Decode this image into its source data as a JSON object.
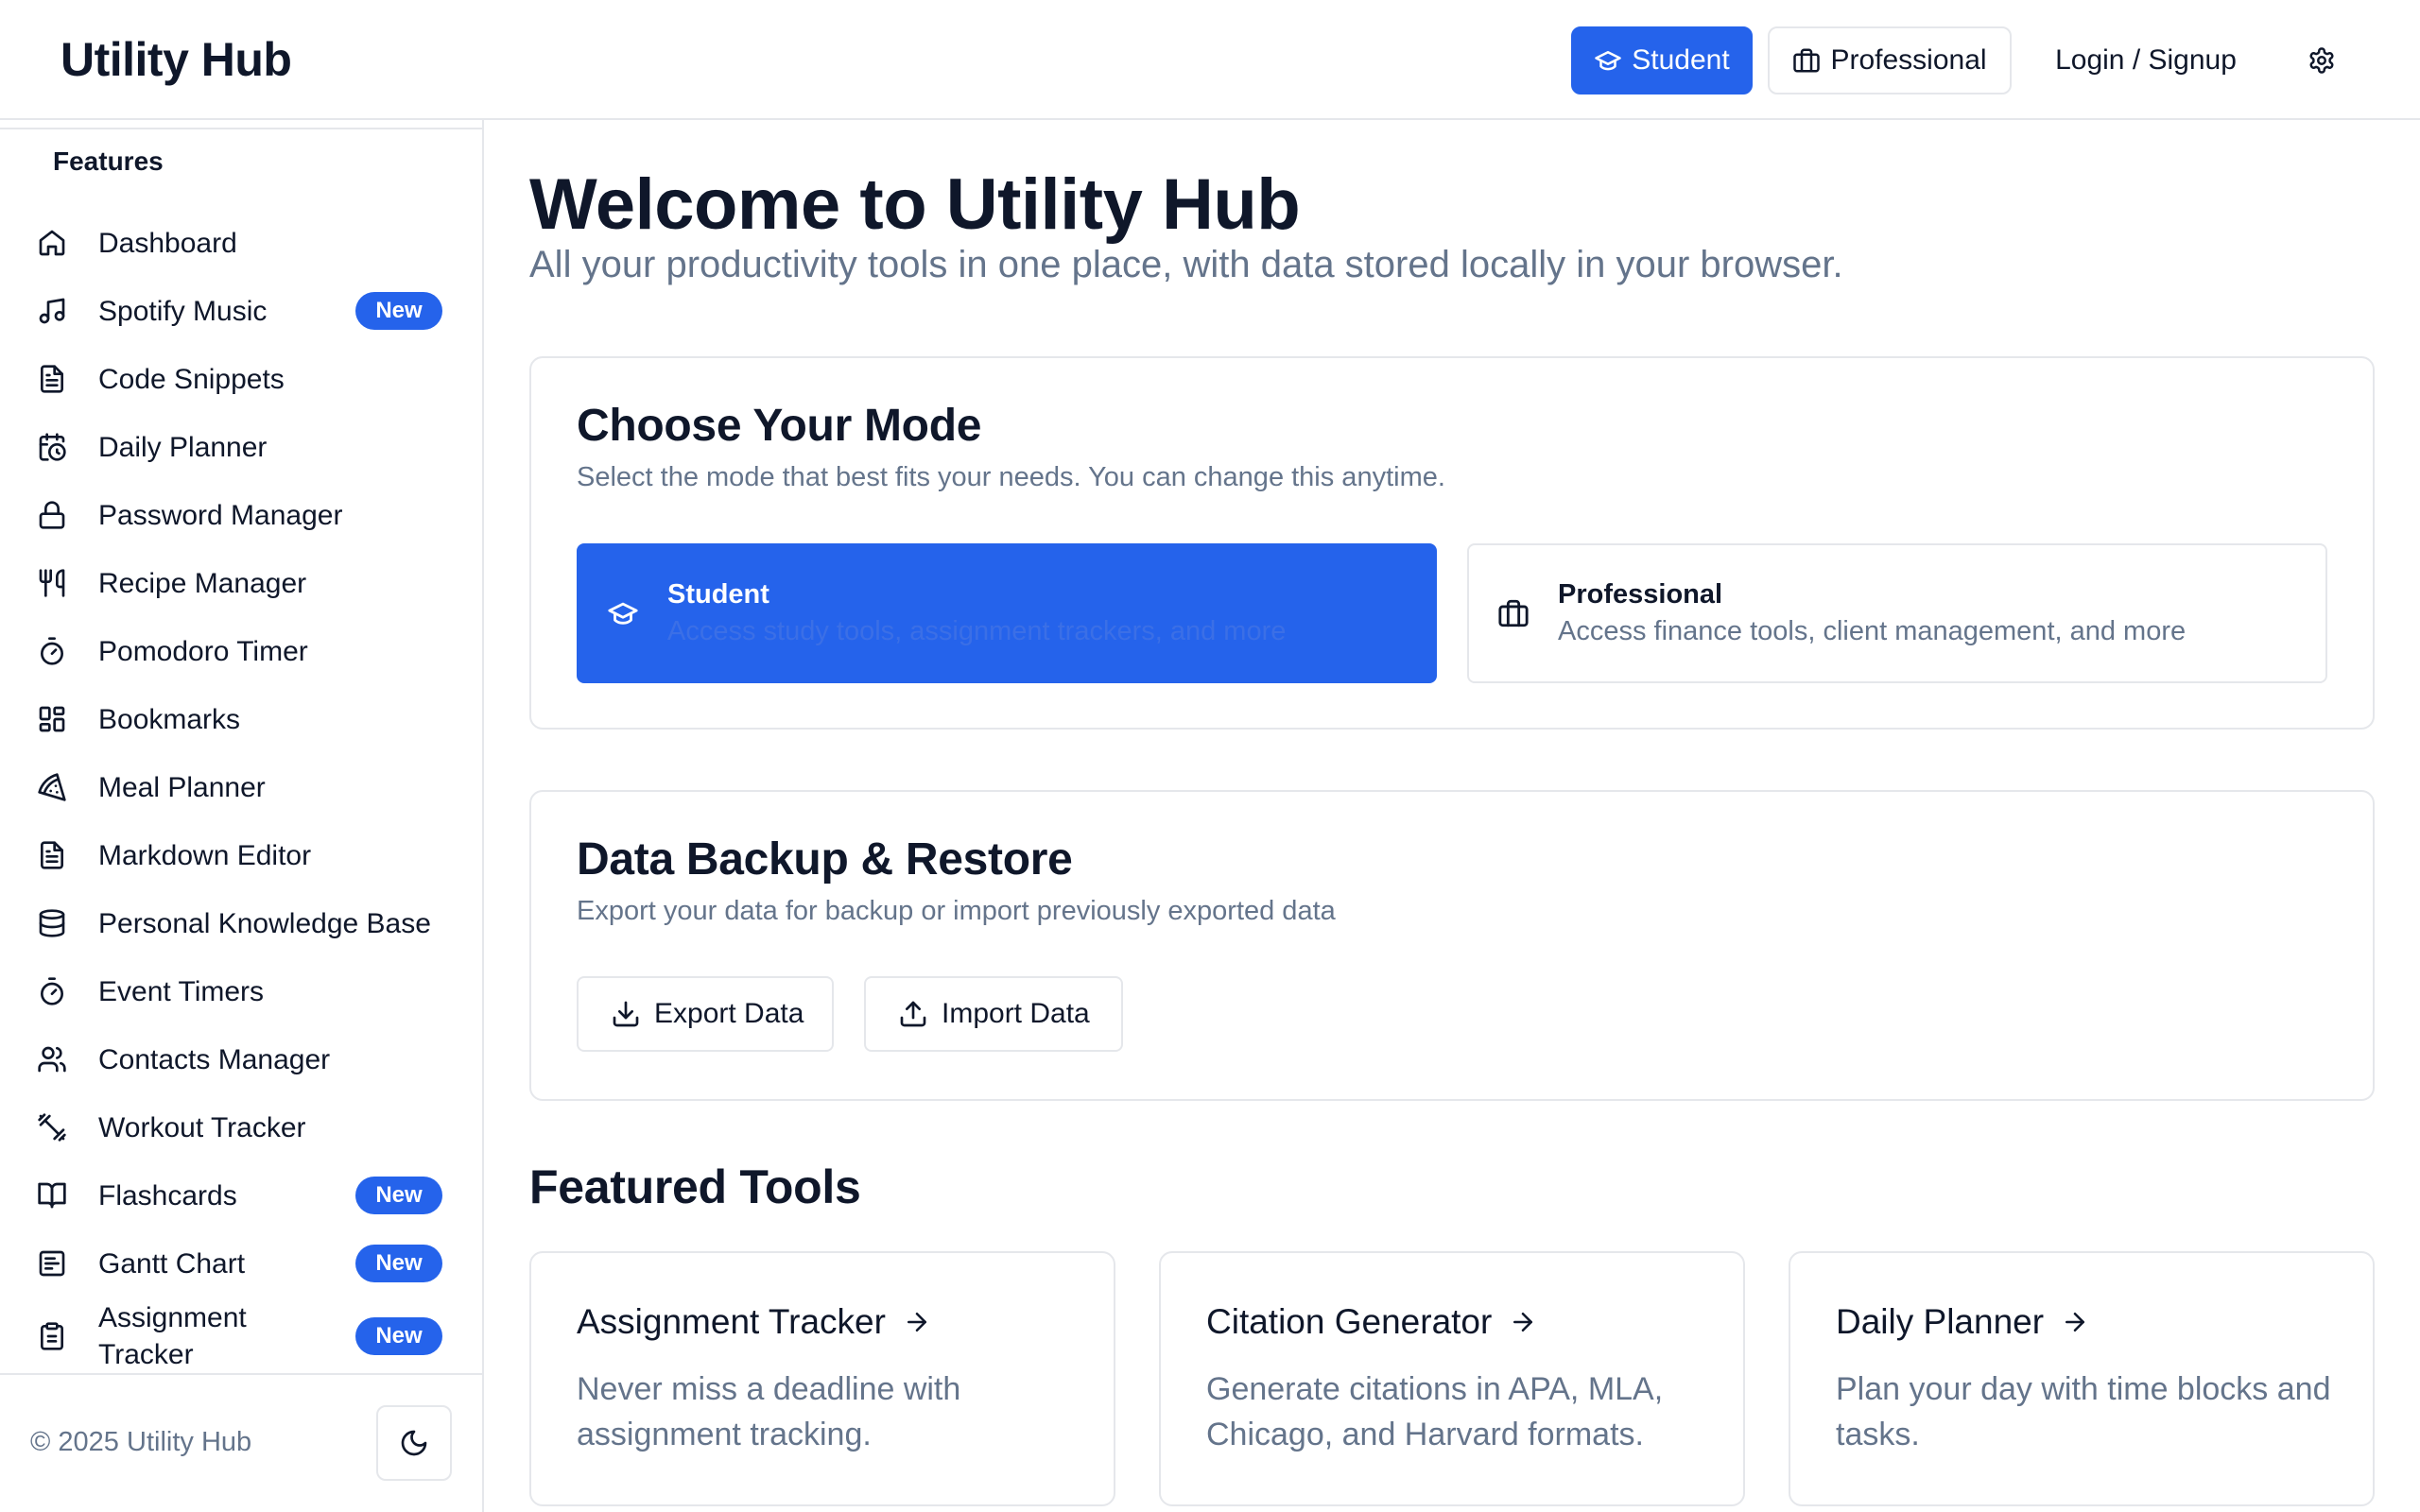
{
  "header": {
    "brand": "Utility Hub",
    "student_label": "Student",
    "professional_label": "Professional",
    "login_label": "Login / Signup"
  },
  "sidebar": {
    "title": "Features",
    "items": [
      {
        "label": "Dashboard",
        "icon": "home-icon"
      },
      {
        "label": "Spotify Music",
        "icon": "music-icon",
        "badge": "New"
      },
      {
        "label": "Code Snippets",
        "icon": "file-text-icon"
      },
      {
        "label": "Daily Planner",
        "icon": "calendar-clock-icon"
      },
      {
        "label": "Password Manager",
        "icon": "lock-icon"
      },
      {
        "label": "Recipe Manager",
        "icon": "utensils-icon"
      },
      {
        "label": "Pomodoro Timer",
        "icon": "timer-icon"
      },
      {
        "label": "Bookmarks",
        "icon": "layout-grid-icon"
      },
      {
        "label": "Meal Planner",
        "icon": "pizza-icon"
      },
      {
        "label": "Markdown Editor",
        "icon": "file-text-icon"
      },
      {
        "label": "Personal Knowledge Base",
        "icon": "database-icon"
      },
      {
        "label": "Event Timers",
        "icon": "timer-icon"
      },
      {
        "label": "Contacts Manager",
        "icon": "users-icon"
      },
      {
        "label": "Workout Tracker",
        "icon": "dumbbell-icon"
      },
      {
        "label": "Flashcards",
        "icon": "book-open-icon",
        "badge": "New"
      },
      {
        "label": "Gantt Chart",
        "icon": "gantt-icon",
        "badge": "New"
      },
      {
        "label": "Assignment\nTracker",
        "icon": "clipboard-icon",
        "badge": "New"
      }
    ],
    "footer": {
      "copyright": "© 2025 Utility Hub"
    }
  },
  "main": {
    "welcome_title": "Welcome to Utility Hub",
    "welcome_subtitle": "All your productivity tools in one place, with data stored locally in your browser.",
    "mode_card": {
      "title": "Choose Your Mode",
      "description": "Select the mode that best fits your needs. You can change this anytime.",
      "student": {
        "name": "Student",
        "description": "Access study tools, assignment trackers, and more"
      },
      "professional": {
        "name": "Professional",
        "description": "Access finance tools, client management, and more"
      }
    },
    "backup_card": {
      "title": "Data Backup & Restore",
      "description": "Export your data for backup or import previously exported data",
      "export_label": "Export Data",
      "import_label": "Import Data"
    },
    "featured": {
      "title": "Featured Tools",
      "tools": [
        {
          "title": "Assignment Tracker",
          "description": "Never miss a deadline with assignment tracking."
        },
        {
          "title": "Citation Generator",
          "description": "Generate citations in APA, MLA, Chicago, and Harvard formats."
        },
        {
          "title": "Daily Planner",
          "description": "Plan your day with time blocks and tasks."
        }
      ]
    }
  },
  "colors": {
    "accent": "#2563eb",
    "text": "#0f172a",
    "muted": "#64748b",
    "border": "#e5e7eb"
  }
}
